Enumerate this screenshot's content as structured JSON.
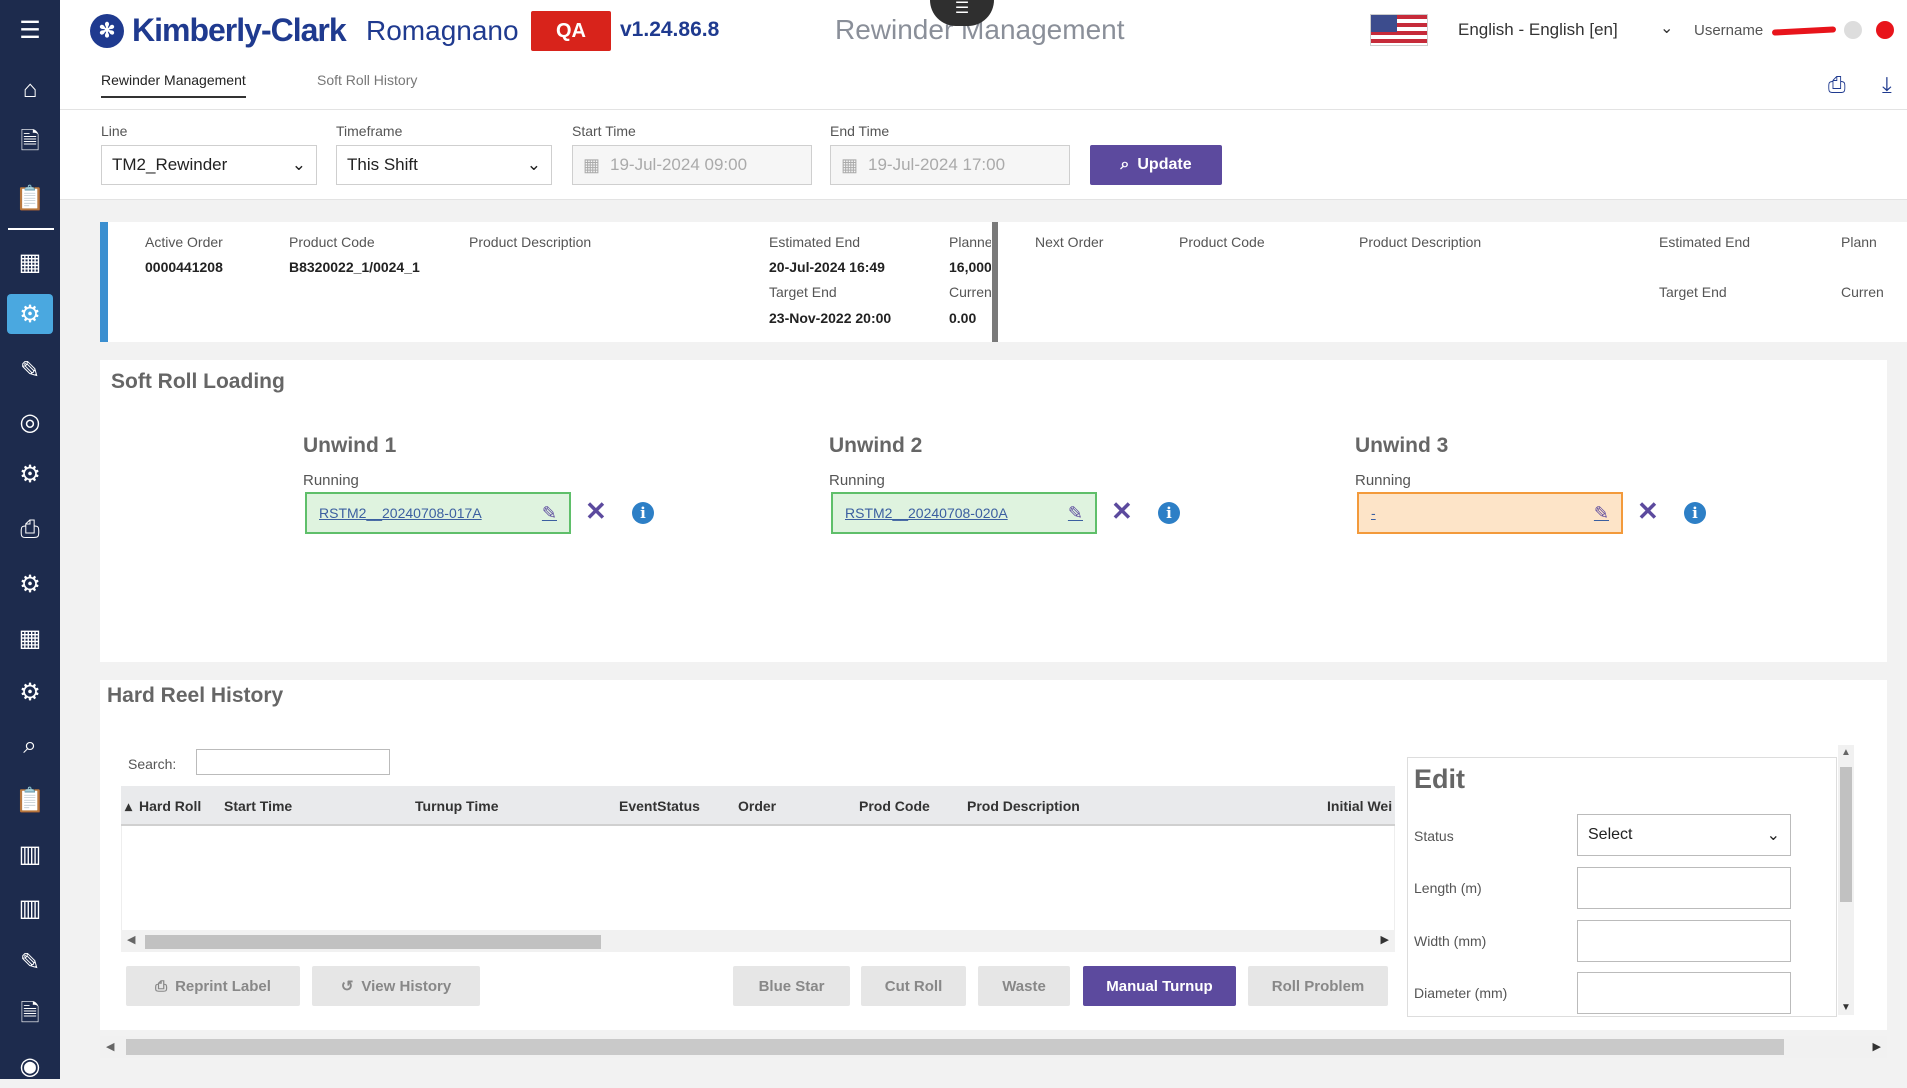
{
  "sidebar": {
    "icons": [
      "menu-icon",
      "home-icon",
      "document-icon",
      "clipboard-icon",
      "calendar-icon",
      "reel-settings-icon",
      "roll-edit-icon",
      "stacked-rolls-icon",
      "reel-gear-icon",
      "printer-icon",
      "reel-gear-icon-2",
      "grid-icon",
      "reel-gear-icon-3",
      "rolls-search-icon",
      "clipboard-icon-2",
      "pallet-icon",
      "pallet-icon-2",
      "rolls-edit-icon",
      "report-edit-icon",
      "location-icon"
    ]
  },
  "header": {
    "brand": "Kimberly-Clark",
    "site": "Romagnano",
    "env_badge": "QA",
    "version": "v1.24.86.8",
    "app_title": "Rewinder Management",
    "language": "English - English [en]",
    "username_label": "Username"
  },
  "tabs": [
    {
      "label": "Rewinder Management",
      "active": true
    },
    {
      "label": "Soft Roll History",
      "active": false
    }
  ],
  "filters": {
    "line_label": "Line",
    "line_value": "TM2_Rewinder",
    "timeframe_label": "Timeframe",
    "timeframe_value": "This Shift",
    "start_label": "Start Time",
    "start_value": "19-Jul-2024 09:00",
    "end_label": "End Time",
    "end_value": "19-Jul-2024 17:00",
    "update_label": "Update"
  },
  "active_order": {
    "order_label": "Active Order",
    "order_value": "0000441208",
    "product_code_label": "Product Code",
    "product_code_value": "B8320022_1/0024_1",
    "product_desc_label": "Product Description",
    "est_end_label": "Estimated End",
    "est_end_value": "20-Jul-2024 16:49",
    "target_end_label": "Target End",
    "target_end_value": "23-Nov-2022 20:00",
    "planned_label": "Planne",
    "planned_value": "16,000",
    "current_label": "Curren",
    "current_value": "0.00"
  },
  "next_order": {
    "order_label": "Next Order",
    "product_code_label": "Product Code",
    "product_desc_label": "Product Description",
    "est_end_label": "Estimated End",
    "target_end_label": "Target End",
    "planned_label": "Plann",
    "current_label": "Curren"
  },
  "soft_roll": {
    "title": "Soft Roll Loading",
    "unwinds": [
      {
        "title": "Unwind 1",
        "status": "Running",
        "value": "RSTM2__20240708-017A"
      },
      {
        "title": "Unwind 2",
        "status": "Running",
        "value": "RSTM2__20240708-020A"
      },
      {
        "title": "Unwind 3",
        "status": "Running",
        "value": "-"
      }
    ]
  },
  "hard_reel": {
    "title": "Hard Reel History",
    "search_label": "Search:",
    "columns": [
      "Hard Roll",
      "Start Time",
      "Turnup Time",
      "EventStatus",
      "Order",
      "Prod Code",
      "Prod Description",
      "Initial Wei"
    ],
    "buttons": {
      "reprint": "Reprint Label",
      "view_history": "View History",
      "blue_star": "Blue Star",
      "cut_roll": "Cut Roll",
      "waste": "Waste",
      "manual_turnup": "Manual Turnup",
      "roll_problem": "Roll Problem"
    }
  },
  "edit": {
    "title": "Edit",
    "status_label": "Status",
    "status_value": "Select",
    "length_label": "Length (m)",
    "width_label": "Width (mm)",
    "diameter_label": "Diameter (mm)"
  },
  "colors": {
    "sidebar": "#1d2b4d",
    "accent": "#5c4a9e",
    "brand": "#1f3a8f",
    "qa": "#d8231b",
    "running": "#dff3df",
    "empty": "#fde4c8"
  }
}
